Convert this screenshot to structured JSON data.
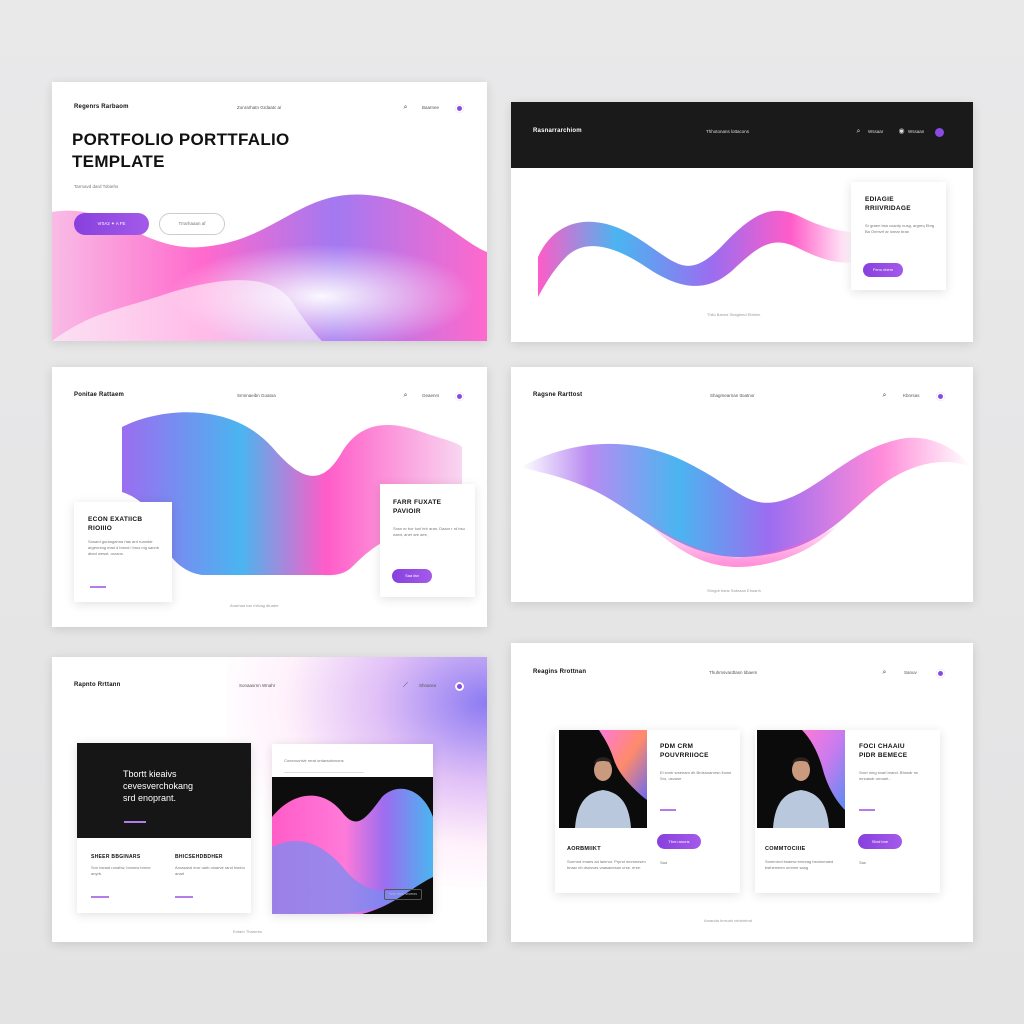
{
  "colors": {
    "accent_purple": "#8a4ce0",
    "accent_pink": "#ff5cc8",
    "accent_blue": "#4ab5f0",
    "dark_band": "#1a1a1a"
  },
  "panel1": {
    "brand": "Regenrs Rarbaom",
    "nav": "Zonrarhatn Grdaatc a/",
    "title_line1": "PORTFOLIO PORTTFALIO",
    "title_line2": "TEMPLATE",
    "subtitle": "Tarmavd dard Tobiehs",
    "cta_primary": "Vr0A2 ✦ A FE",
    "cta_secondary": "Trrarhaaan af",
    "icons": [
      "search-icon",
      "purple-dot-icon"
    ]
  },
  "panel2": {
    "brand": "Rasnarrarchiom",
    "nav": "Thhotonans lottacons",
    "nav_link2": "Wssaar",
    "nav_link3": "Wssaan",
    "card_title_line1": "EDIAGIE",
    "card_title_line2": "RRIIVRIDAGE",
    "card_text": "Sr graen bsa cuardy nusg, argreq Ebrg Ba Onmvrf ar lomar bran",
    "card_button": "Fenu nbem",
    "footer": "Thilo Bannd Shagbmd Ebbhm"
  },
  "panel3": {
    "brand": "Ponitae Rattaem",
    "nav": "Smnnaeibn Goatoa",
    "nav_link2": "Geaenrs",
    "card_left_title_line1": "ECON EXATIICB",
    "card_left_title_line2": "RIOIIIO",
    "card_left_text": "Sosard gorauganna rtas ard ruanddr argeorsng mad d brsnd l brus mg sannb abed wesst. oorans.",
    "card_right_title_line1": "FARR FUXATE",
    "card_right_title_line2": "PAVIOIR",
    "card_right_text": "Sosn er bor lunl hrb aran, Daaor r rd bsu naed, aner are aee,",
    "card_right_button": "Saa fan",
    "footer": "Anarhaa bar rhilvag dfuatre"
  },
  "panel4": {
    "brand": "Ragsne Rarttost",
    "nav": "Shagmearnan ttoatnor",
    "nav_link2": "Kbnrsas",
    "footer": "Shngdr bans Sabraan Ehuanh"
  },
  "panel5": {
    "brand": "Rapnto Rrttann",
    "nav": "Sonaasrnn Wnahr",
    "nav_link2": "Shnarea",
    "dark_card_line1": "Tbortt kieaivs",
    "dark_card_line2": "cevesverchokang",
    "dark_card_line3": "srd enoprant.",
    "col1_title": "SHEER BBGINARS",
    "col1_text": "Snn bsnad ronahw, browrw brnne anyrb.",
    "col2_title": "BHICSEHDBDHER",
    "col2_text": "Aruasand eror uarb oiuarve rand hsnbo anart",
    "image_card_label": "Coneroonivir rerat ordarsahvnons",
    "image_card_text": "Snnr ener sroeros",
    "footer": "Enfarh Tharnrbs"
  },
  "panel6": {
    "brand": "Reagins Rrottnan",
    "nav": "Thuhmsvardtasn tibaem",
    "nav_link2": "Sanuv",
    "card1_title_line1": "PDM CRM",
    "card1_title_line2": "POUVRRIIOCE",
    "card1_text": "Ei snnb srsenam dh Brdsnnanrrsn lhone Sro, usvane",
    "card1_label": "AORBMIIKT",
    "card1_button": "Tbnn anuns",
    "card1_text2": "Sorrnnd enaes ad lamnor. Prpnd mnrseosen bnasr nb dsnsvas vaasanesan orse. erse.",
    "card2_title_line1": "FOCI CHAAIU",
    "card2_title_line2": "PIDR BEMECE",
    "card2_text": "Srurt nmg snarl brand. Bhnsdr rw mnnasdr ornoarl...",
    "card2_label": "COMMTOCIIIE",
    "card2_button": "Sbrd bne",
    "card2_text2": "Somrnrnd bsamw ernnrag bsnnnmaed bsfnenmen ornnne sang",
    "footer": "Amanda hrrruah vrtnbntrnd"
  }
}
